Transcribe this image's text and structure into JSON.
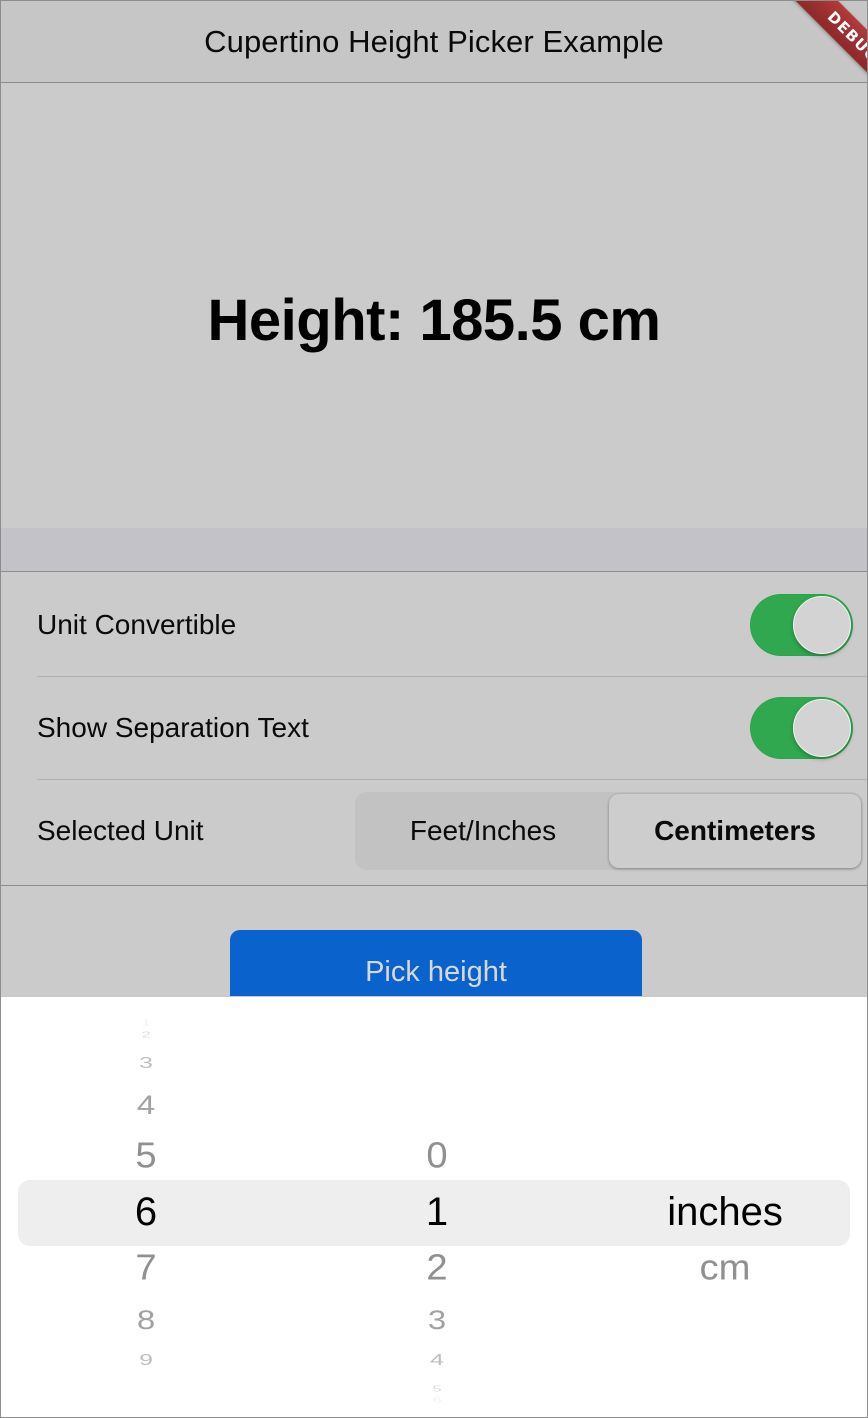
{
  "app": {
    "title": "Cupertino Height Picker Example",
    "debug_banner": "DEBUG"
  },
  "display": {
    "height_text": "Height: 185.5 cm"
  },
  "settings": {
    "rows": [
      {
        "label": "Unit Convertible",
        "control": "switch",
        "value": "on"
      },
      {
        "label": "Show Separation Text",
        "control": "switch",
        "value": "on"
      }
    ],
    "selected_unit": {
      "label": "Selected Unit",
      "options": [
        "Feet/Inches",
        "Centimeters"
      ],
      "selected": "Centimeters"
    }
  },
  "actions": {
    "pick_height_label": "Pick height"
  },
  "picker": {
    "feet_column": {
      "values": [
        "1",
        "2",
        "3",
        "4",
        "5",
        "6",
        "7",
        "8",
        "9"
      ],
      "selected": "6"
    },
    "inches_column": {
      "values": [
        "0",
        "1",
        "2",
        "3",
        "4",
        "5",
        "6"
      ],
      "selected": "1"
    },
    "unit_column": {
      "values": [
        "inches",
        "cm"
      ],
      "selected": "inches"
    }
  },
  "colors": {
    "background": "#cbcbcb",
    "appbar": "#c6c6c6",
    "switch_on": "#2fa84f",
    "button_blue": "#0a62cc",
    "debug_red": "#9c3030",
    "selection_band": "#eeeeee"
  }
}
